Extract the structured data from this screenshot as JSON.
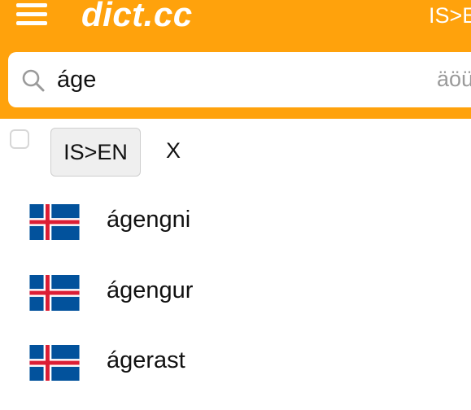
{
  "header": {
    "logo_text": "dict.cc",
    "language_label": "IS>E",
    "brand_color": "#ffa20c"
  },
  "search": {
    "value": "áge",
    "special_chars": "äöü",
    "icon": "search-icon"
  },
  "filter": {
    "language_pair_label": "IS>EN",
    "clear_label": "X"
  },
  "results": [
    {
      "word": "ágengni",
      "flag": "iceland-flag"
    },
    {
      "word": "ágengur",
      "flag": "iceland-flag"
    },
    {
      "word": "ágerast",
      "flag": "iceland-flag"
    }
  ]
}
